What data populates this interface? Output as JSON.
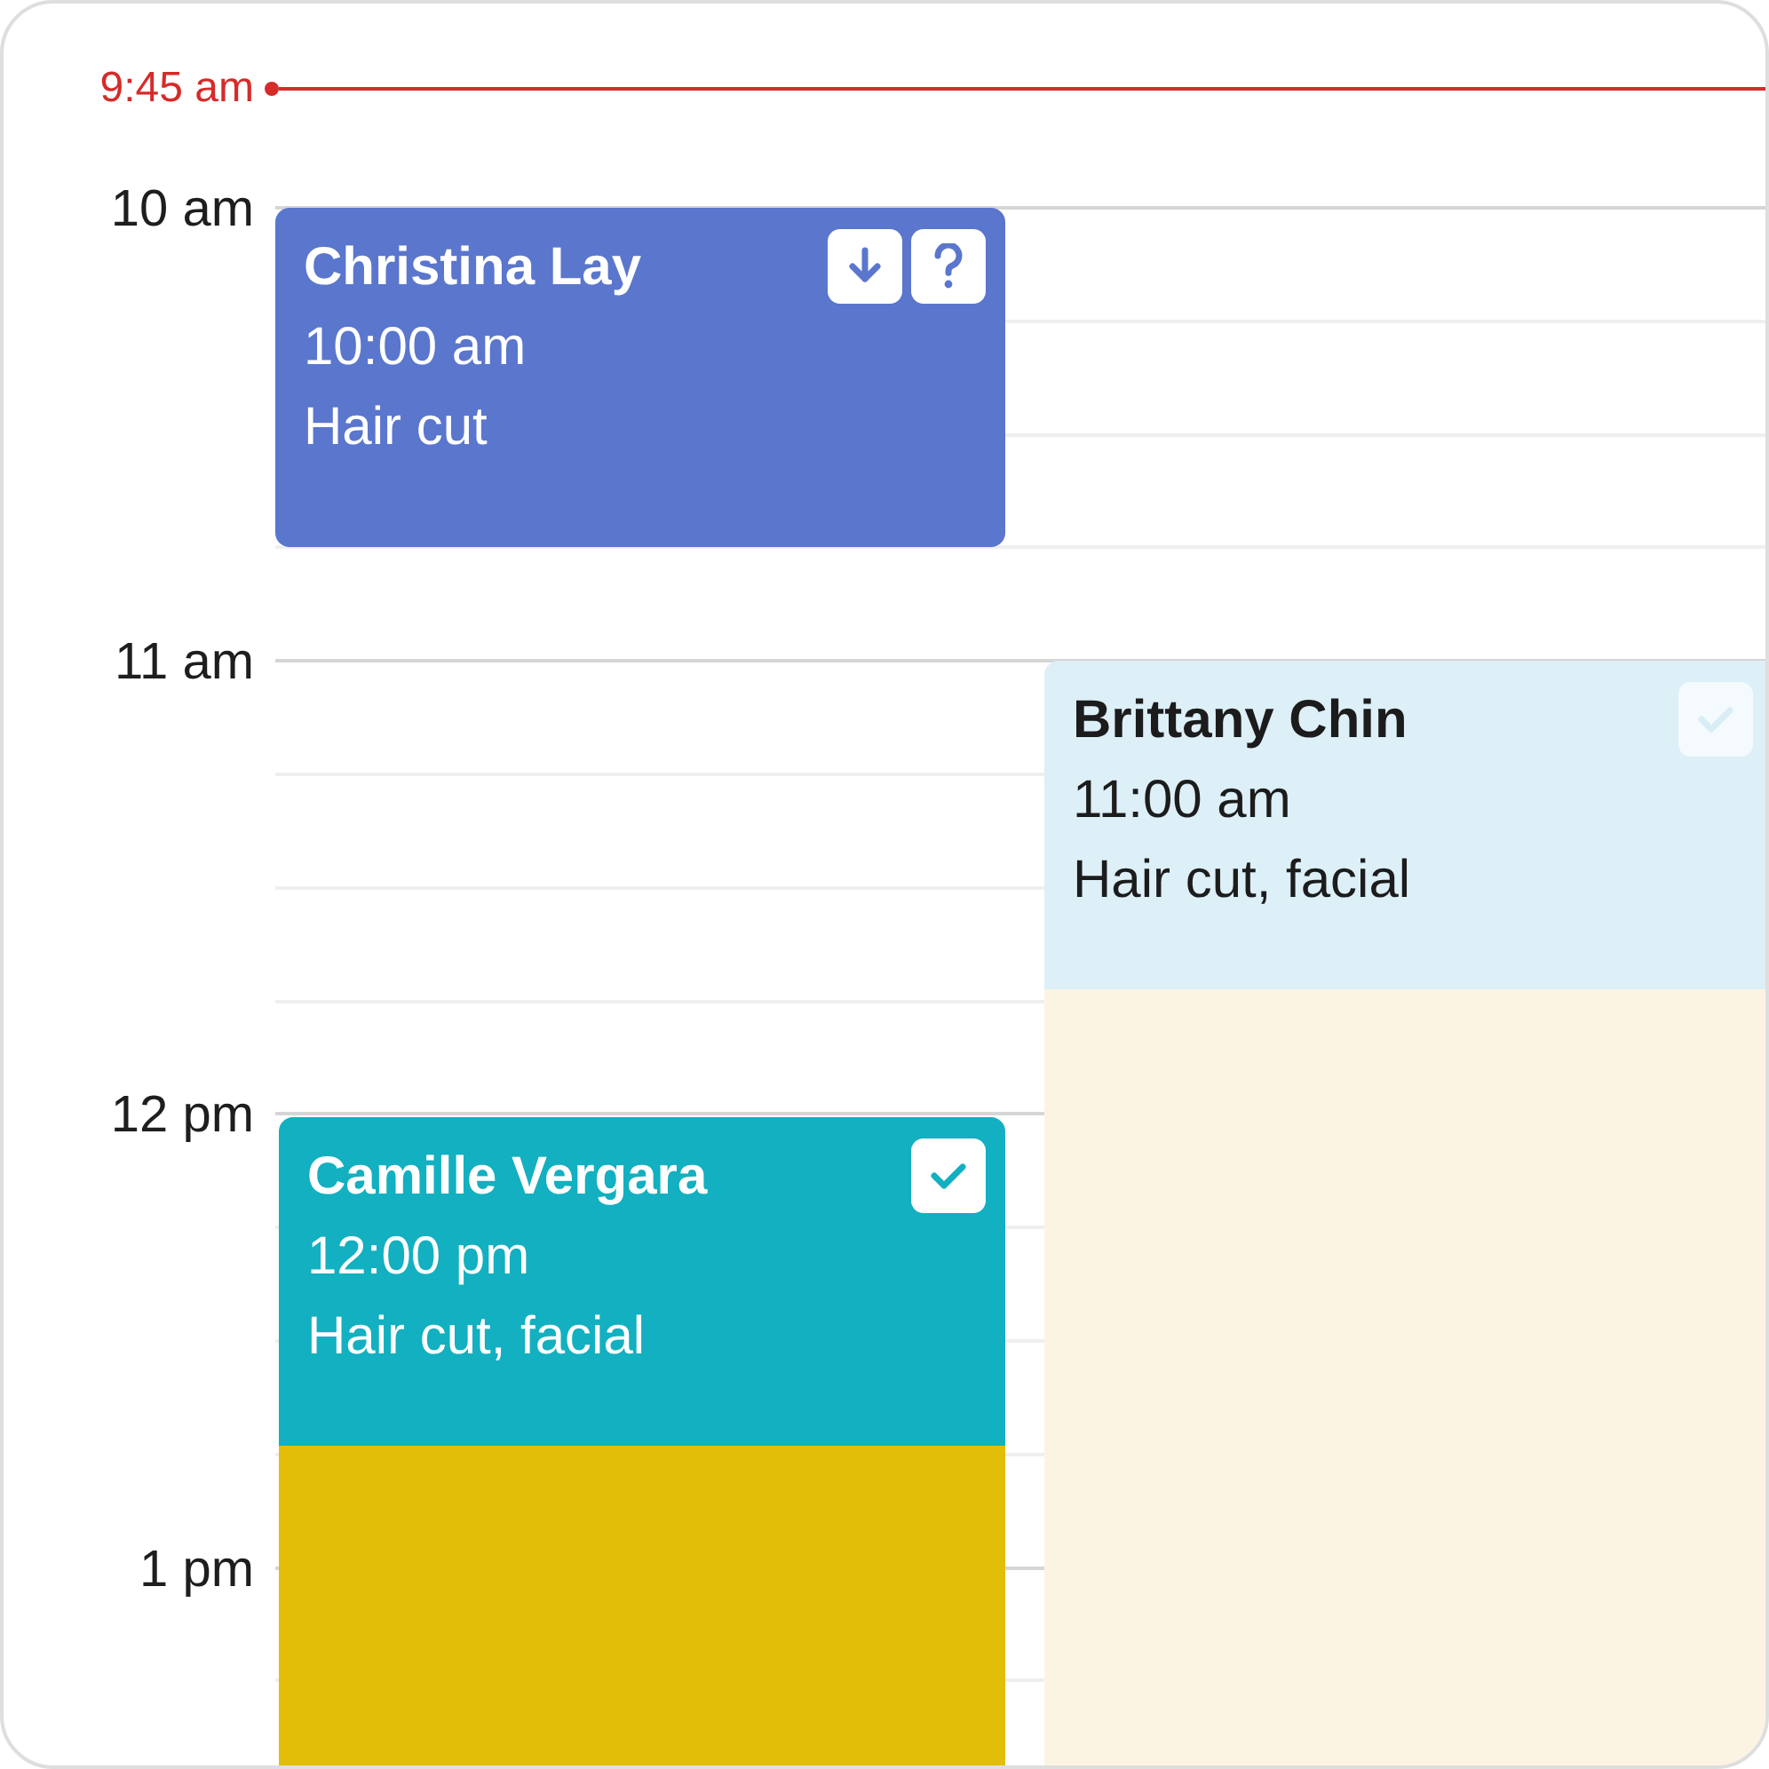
{
  "now": {
    "label": "9:45 am"
  },
  "hours": [
    "10 am",
    "11 am",
    "12 pm",
    "1 pm"
  ],
  "events": [
    {
      "name": "Christina Lay",
      "time": "10:00 am",
      "service": "Hair cut",
      "color": "#5a76cd",
      "badges": [
        {
          "kind": "arrow",
          "disabled": false
        },
        {
          "kind": "question",
          "disabled": false
        }
      ]
    },
    {
      "name": "Brittany Chin",
      "time": "11:00 am",
      "service": "Hair cut, facial",
      "color": "#ddeff7",
      "badges": [
        {
          "kind": "check",
          "disabled": true
        }
      ]
    },
    {
      "name": "Camille Vergara",
      "time": "12:00 pm",
      "service": "Hair cut, facial",
      "color": "#12b0c0",
      "badges": [
        {
          "kind": "check",
          "disabled": false
        }
      ]
    }
  ],
  "blocks": [
    {
      "color": "#fcf4e3"
    },
    {
      "color": "#e3be08"
    }
  ]
}
